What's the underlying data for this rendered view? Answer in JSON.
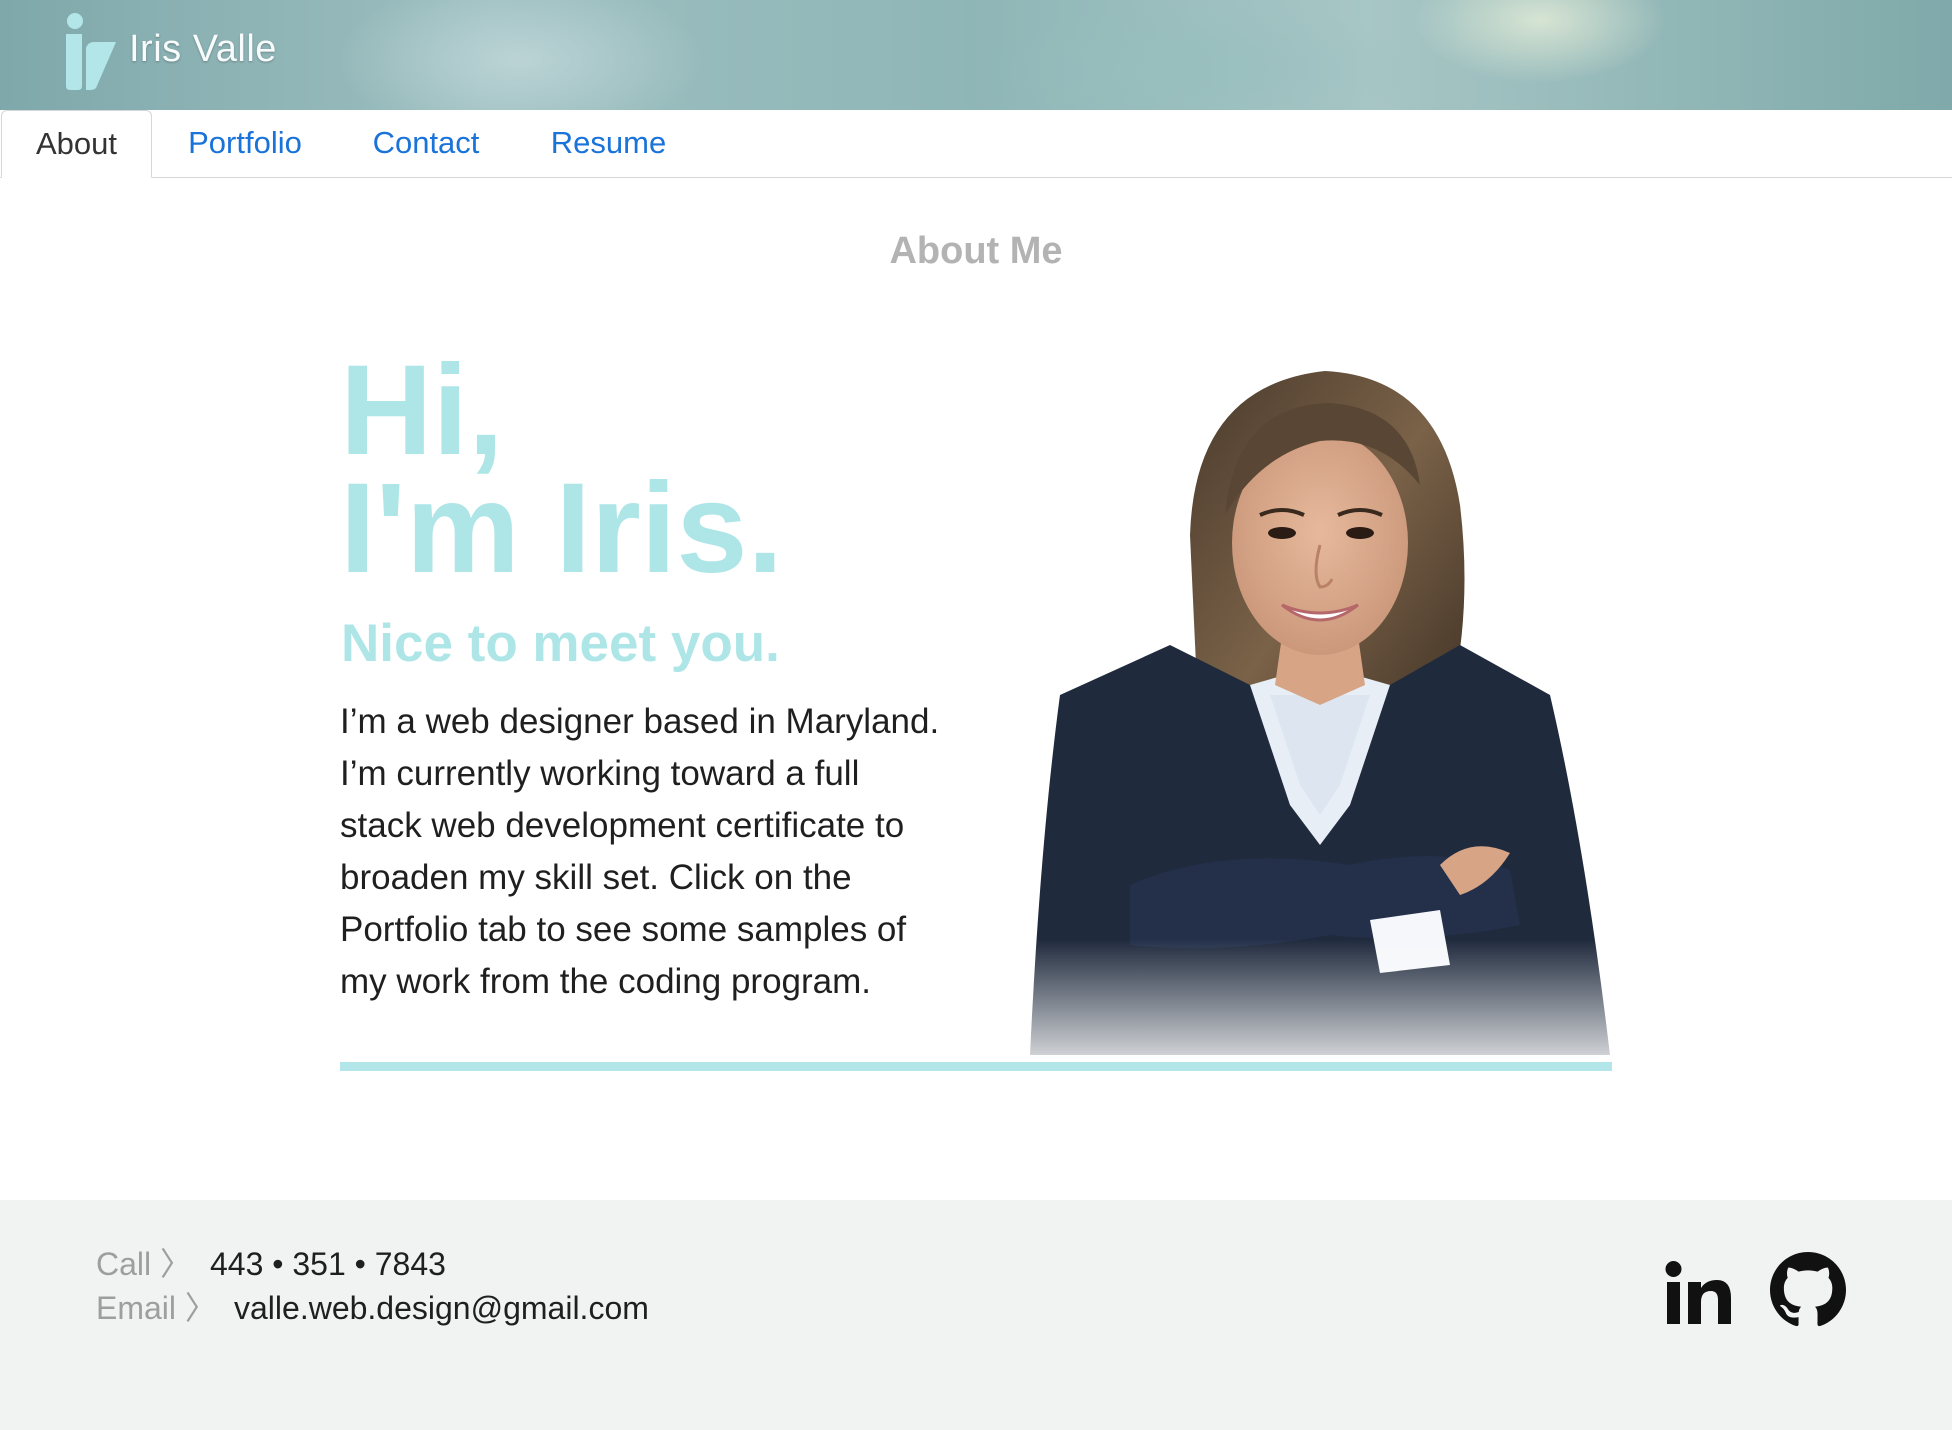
{
  "header": {
    "brand_name": "Iris Valle",
    "logo_icon": "iv-monogram-logo",
    "accent": "#aee6e8"
  },
  "nav": {
    "tabs": [
      {
        "label": "About",
        "active": true
      },
      {
        "label": "Portfolio",
        "active": false
      },
      {
        "label": "Contact",
        "active": false
      },
      {
        "label": "Resume",
        "active": false
      }
    ],
    "link_color": "#1a73d9"
  },
  "about": {
    "section_title": "About Me",
    "greeting_line1": "Hi,",
    "greeting_line2": "I'm Iris.",
    "subheading": "Nice to meet you.",
    "bio_lines": [
      "I’m a web designer based in Maryland.",
      "I’m currently working toward a full",
      "stack web development certificate to",
      "broaden my skill set. Click on the",
      "Portfolio tab to see some samples of",
      "my work from the coding program."
    ],
    "portrait": "portrait-photo"
  },
  "footer": {
    "call_label": "Call 〉",
    "phone": "443 • 351 • 7843",
    "email_label": "Email 〉",
    "email": "valle.web.design@gmail.com",
    "social": [
      {
        "icon": "linkedin-icon"
      },
      {
        "icon": "github-icon"
      }
    ]
  }
}
